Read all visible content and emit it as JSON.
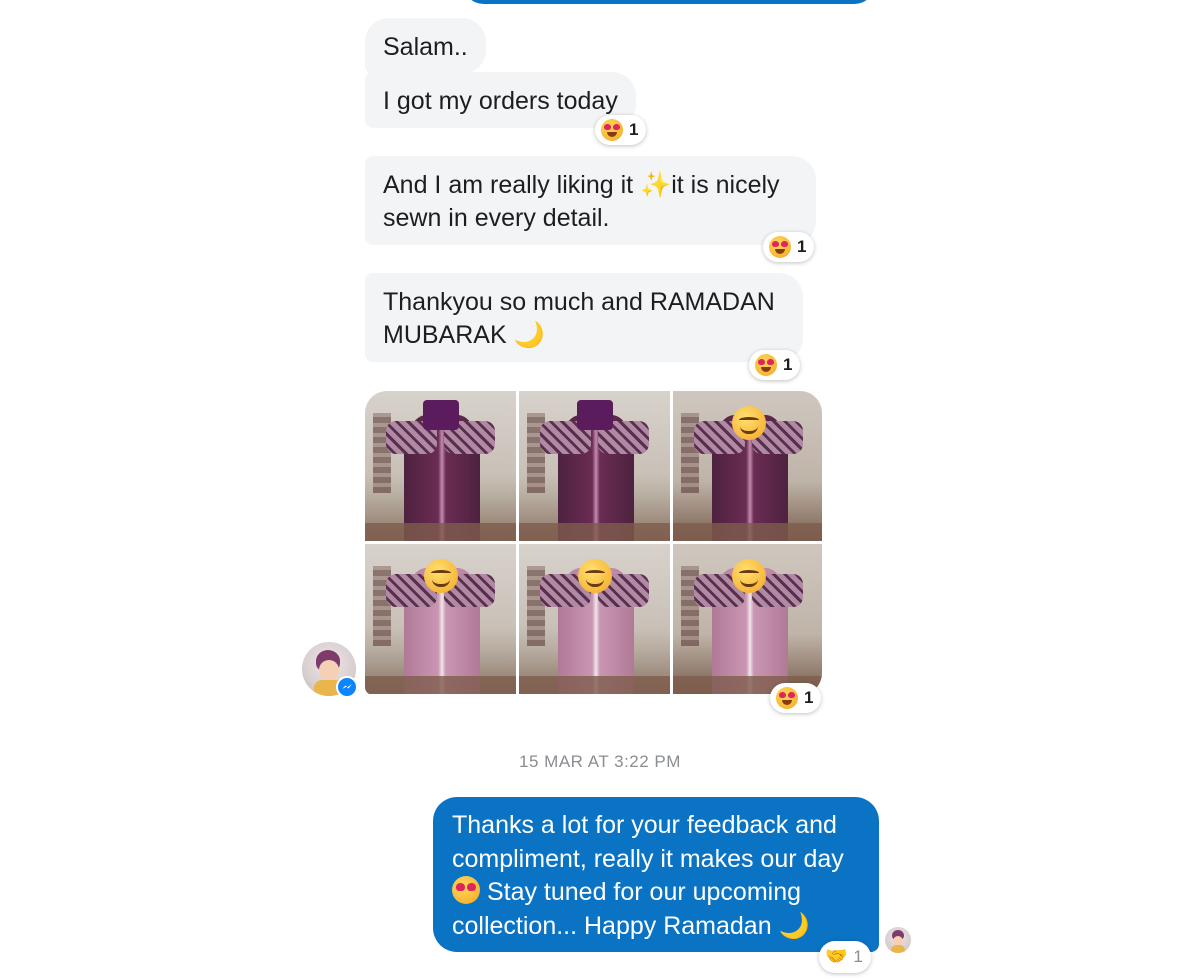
{
  "thread": {
    "incoming": [
      {
        "text": "Salam.."
      },
      {
        "text": "I got my orders today",
        "reaction": {
          "emoji": "heart-eyes",
          "count": "1"
        }
      },
      {
        "text_before": "And I am really liking it ",
        "sparkle": "✨",
        "text_after": "it is nicely sewn in every detail.",
        "reaction": {
          "emoji": "heart-eyes",
          "count": "1"
        }
      },
      {
        "text": "Thankyou so much and RAMADAN MUBARAK ",
        "moon": "🌙",
        "reaction": {
          "emoji": "heart-eyes",
          "count": "1"
        }
      }
    ],
    "photos": {
      "count": 6,
      "reaction": {
        "emoji": "heart-eyes",
        "count": "1"
      }
    },
    "timestamp": "15 MAR AT 3:22 PM",
    "outgoing": {
      "text_part1": "Thanks a lot for your feedback and compliment, really it makes our day ",
      "text_part2": " Stay tuned for our upcoming collection... Happy Ramadan ",
      "moon": "🌙",
      "reaction": {
        "emoji": "handshake",
        "count": "1"
      }
    }
  },
  "colors": {
    "outgoing_bubble": "#0b73c4",
    "incoming_bubble": "#f3f4f6",
    "timestamp": "#8a8d91",
    "messenger_badge": "#0a84ff"
  }
}
